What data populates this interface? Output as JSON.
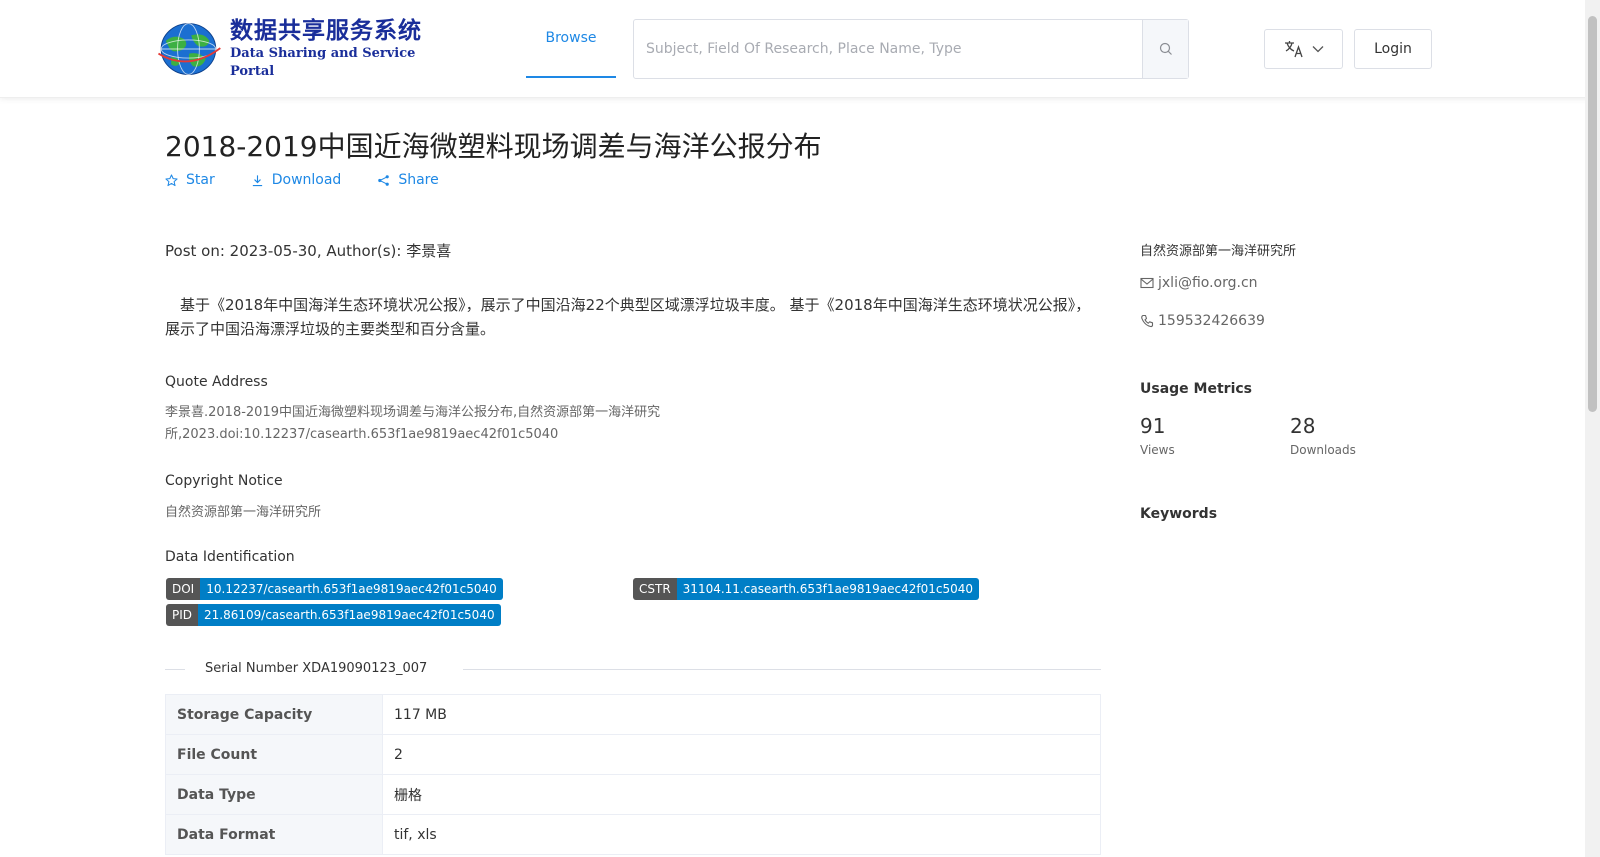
{
  "header": {
    "logo_cn": "数据共享服务系统",
    "logo_en": "Data Sharing and Service Portal",
    "nav_browse": "Browse",
    "search_placeholder": "Subject, Field Of Research, Place Name, Type",
    "login_label": "Login"
  },
  "dataset": {
    "title": "2018-2019中国近海微塑料现场调差与海洋公报分布",
    "actions": {
      "star": "Star",
      "download": "Download",
      "share": "Share"
    },
    "post_line": "Post on: 2023-05-30, Author(s): 李景喜",
    "abstract": "基于《2018年中国海洋生态环境状况公报》，展示了中国沿海22个典型区域漂浮垃圾丰度。 基于《2018年中国海洋生态环境状况公报》，展示了中国沿海漂浮垃圾的主要类型和百分含量。",
    "quote_label": "Quote Address",
    "quote_text": "李景喜.2018-2019中国近海微塑料现场调差与海洋公报分布,自然资源部第一海洋研究所,2023.doi:10.12237/casearth.653f1ae9819aec42f01c5040",
    "copyright_label": "Copyright Notice",
    "copyright_text": "自然资源部第一海洋研究所",
    "identification_label": "Data Identification",
    "identifiers": {
      "doi": {
        "key": "DOI",
        "value": "10.12237/casearth.653f1ae9819aec42f01c5040"
      },
      "cstr": {
        "key": "CSTR",
        "value": "31104.11.casearth.653f1ae9819aec42f01c5040"
      },
      "pid": {
        "key": "PID",
        "value": "21.86109/casearth.653f1ae9819aec42f01c5040"
      }
    },
    "serial": "Serial Number XDA19090123_007",
    "meta": [
      {
        "label": "Storage Capacity",
        "value": "117 MB"
      },
      {
        "label": "File Count",
        "value": "2"
      },
      {
        "label": "Data Type",
        "value": "栅格"
      },
      {
        "label": "Data Format",
        "value": "tif, xls"
      }
    ]
  },
  "sidebar": {
    "organization": "自然资源部第一海洋研究所",
    "email": "jxli@fio.org.cn",
    "phone": "159532426639",
    "usage_heading": "Usage Metrics",
    "views": {
      "value": "91",
      "label": "Views"
    },
    "downloads": {
      "value": "28",
      "label": "Downloads"
    },
    "keywords_heading": "Keywords"
  },
  "colors": {
    "accent": "#1e88e5",
    "badge_key": "#555555",
    "badge_value": "#007ec6",
    "logo_blue": "#1a2e9a"
  }
}
